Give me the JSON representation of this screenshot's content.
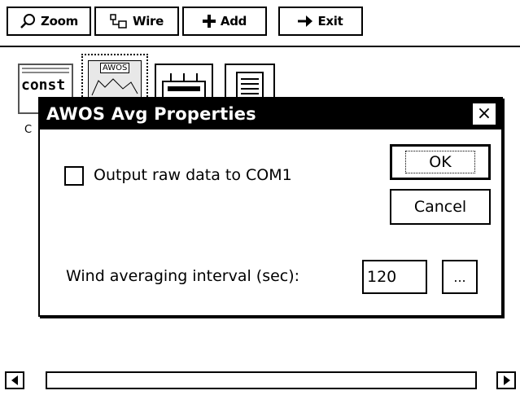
{
  "toolbar": {
    "zoom_label": "Zoom",
    "wire_label": "Wire",
    "add_label": "Add",
    "exit_label": "Exit"
  },
  "canvas": {
    "const_block_label": "const",
    "awos_block_label": "AWOS",
    "partial_caption": "C"
  },
  "dialog": {
    "title": "AWOS Avg Properties",
    "close_glyph": "×",
    "checkbox_label": "Output raw data to COM1",
    "checkbox_checked": false,
    "ok_label": "OK",
    "cancel_label": "Cancel",
    "interval_label": "Wind averaging interval (sec):",
    "interval_value": "120",
    "browse_label": "..."
  },
  "icons": {
    "zoom": "magnifier-icon",
    "wire": "wire-icon",
    "add": "plus-icon",
    "exit": "arrow-right-icon",
    "scroll_left": "triangle-left-icon",
    "scroll_right": "triangle-right-icon"
  }
}
